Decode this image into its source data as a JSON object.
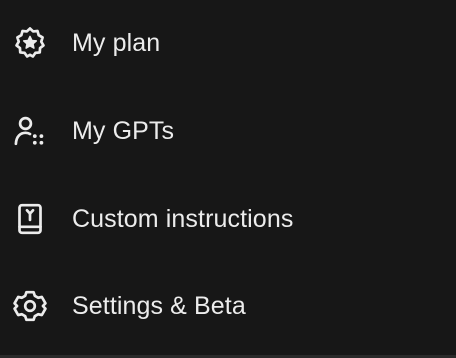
{
  "menu": {
    "items": [
      {
        "label": "My plan",
        "icon": "plan-star-badge-icon"
      },
      {
        "label": "My GPTs",
        "icon": "gpts-user-dots-icon"
      },
      {
        "label": "Custom instructions",
        "icon": "instructions-book-icon"
      },
      {
        "label": "Settings & Beta",
        "icon": "settings-gear-icon"
      }
    ]
  },
  "colors": {
    "background": "#171717",
    "text": "#ececec",
    "divider": "#2a2a2a"
  }
}
